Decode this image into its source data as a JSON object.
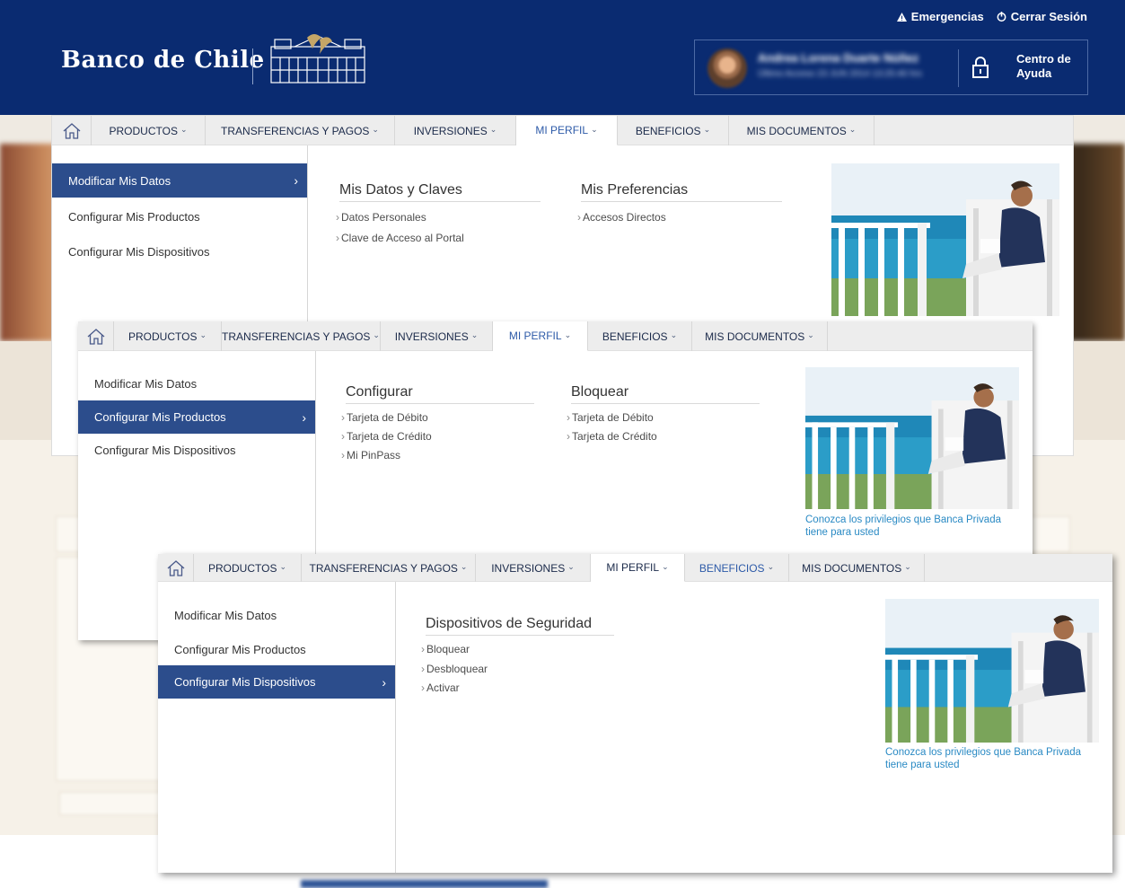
{
  "header": {
    "brand": "Banco de Chile",
    "top_links": [
      {
        "label": "Emergencias",
        "icon": "warning-icon"
      },
      {
        "label": "Cerrar Sesión",
        "icon": "logout-icon"
      }
    ],
    "help_label": "Centro de Ayuda",
    "user_name_blurred": "Andrea Lorena Duarte Núñez",
    "user_access_blurred": "Último Acceso 23 JUN 2014 13:25:46 hrs"
  },
  "nav": {
    "home_icon": "home-icon",
    "items": [
      "PRODUCTOS",
      "TRANSFERENCIAS Y PAGOS",
      "INVERSIONES",
      "MI PERFIL",
      "BENEFICIOS",
      "MIS DOCUMENTOS"
    ],
    "active": "MI PERFIL"
  },
  "panel1": {
    "side": [
      "Modificar Mis Datos",
      "Configurar Mis Productos",
      "Configurar Mis Dispositivos"
    ],
    "columns": [
      {
        "title": "Mis Datos y Claves",
        "links": [
          "Datos Personales",
          "Clave de Acceso al Portal"
        ]
      },
      {
        "title": "Mis Preferencias",
        "links": [
          "Accesos Directos"
        ]
      }
    ]
  },
  "panel2": {
    "side": [
      "Modificar Mis Datos",
      "Configurar Mis Productos",
      "Configurar Mis Dispositivos"
    ],
    "columns": [
      {
        "title": "Configurar",
        "links": [
          "Tarjeta de Débito",
          "Tarjeta de Crédito",
          "Mi PinPass"
        ]
      },
      {
        "title": "Bloquear",
        "links": [
          "Tarjeta de Débito",
          "Tarjeta de Crédito"
        ]
      }
    ],
    "promo_caption": "Conozca los privilegios que Banca Privada tiene para usted"
  },
  "panel3": {
    "side": [
      "Modificar Mis Datos",
      "Configurar Mis Productos",
      "Configurar Mis Dispositivos"
    ],
    "columns": [
      {
        "title": "Dispositivos de Seguridad",
        "links": [
          "Bloquear",
          "Desbloquear",
          "Activar"
        ]
      }
    ],
    "promo_caption": "Conozca los privilegios que Banca Privada tiene para usted"
  },
  "colors": {
    "header_bg": "#0a2b71",
    "side_selected": "#2c4d8c",
    "nav_active_text": "#2d5aa8",
    "promo_link": "#2a8ac4"
  }
}
